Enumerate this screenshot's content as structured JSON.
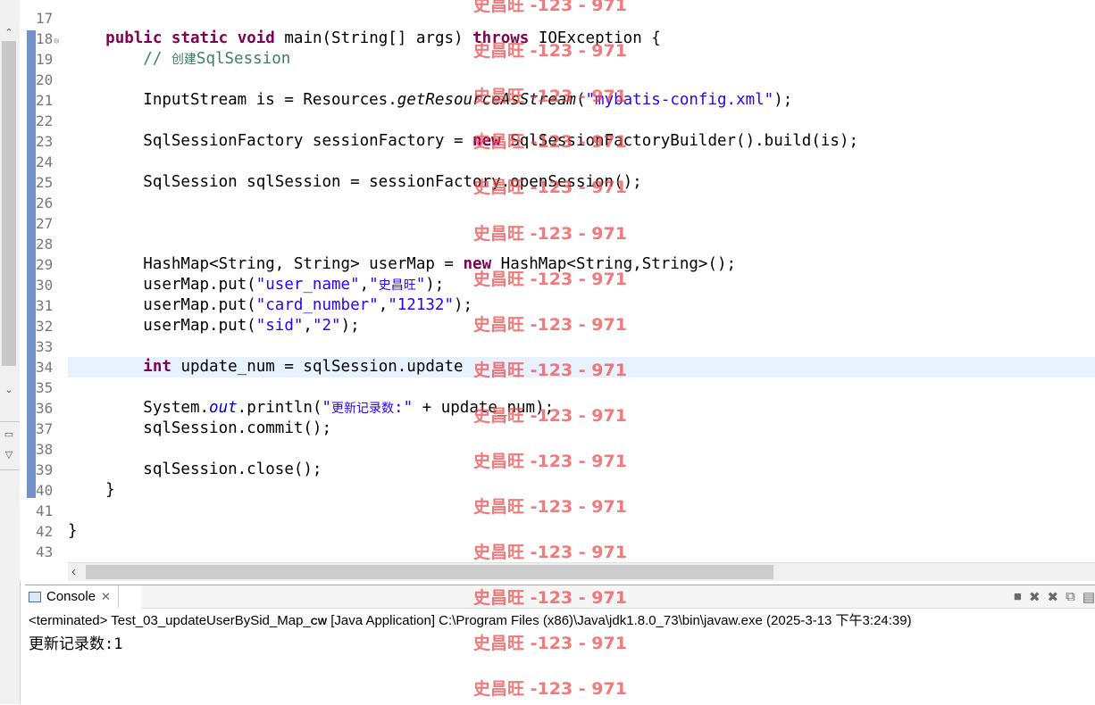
{
  "editor": {
    "lines": [
      {
        "n": "17",
        "tokens": []
      },
      {
        "n": "18",
        "fold": "⊖",
        "tokens": [
          {
            "t": "    "
          },
          {
            "t": "public",
            "c": "kw"
          },
          {
            "t": " "
          },
          {
            "t": "static",
            "c": "kw"
          },
          {
            "t": " "
          },
          {
            "t": "void",
            "c": "kw"
          },
          {
            "t": " main(String[] args) "
          },
          {
            "t": "throws",
            "c": "kw"
          },
          {
            "t": " IOException {"
          }
        ]
      },
      {
        "n": "19",
        "tokens": [
          {
            "t": "        "
          },
          {
            "t": "// ",
            "c": "cm"
          },
          {
            "t": "创建",
            "c": "cm cjk"
          },
          {
            "t": "SqlSession",
            "c": "cm"
          }
        ]
      },
      {
        "n": "20",
        "tokens": []
      },
      {
        "n": "21",
        "tokens": [
          {
            "t": "        InputStream is = Resources."
          },
          {
            "t": "getResourceAsStream",
            "c": "it"
          },
          {
            "t": "("
          },
          {
            "t": "\"mybatis-config.xml\"",
            "c": "str"
          },
          {
            "t": ");"
          }
        ]
      },
      {
        "n": "22",
        "tokens": []
      },
      {
        "n": "23",
        "tokens": [
          {
            "t": "        SqlSessionFactory sessionFactory = "
          },
          {
            "t": "new",
            "c": "kw"
          },
          {
            "t": " SqlSessionFactoryBuilder().build(is);"
          }
        ]
      },
      {
        "n": "24",
        "tokens": []
      },
      {
        "n": "25",
        "tokens": [
          {
            "t": "        SqlSession sqlSession = sessionFactory.openSession();"
          }
        ]
      },
      {
        "n": "26",
        "tokens": []
      },
      {
        "n": "27",
        "tokens": []
      },
      {
        "n": "28",
        "tokens": []
      },
      {
        "n": "29",
        "tokens": [
          {
            "t": "        HashMap<String, String> userMap = "
          },
          {
            "t": "new",
            "c": "kw"
          },
          {
            "t": " HashMap<String,String>();"
          }
        ]
      },
      {
        "n": "30",
        "tokens": [
          {
            "t": "        userMap.put("
          },
          {
            "t": "\"user_name\"",
            "c": "str"
          },
          {
            "t": ","
          },
          {
            "t": "\"",
            "c": "str"
          },
          {
            "t": "史昌旺",
            "c": "str cjk"
          },
          {
            "t": "\"",
            "c": "str"
          },
          {
            "t": ");"
          }
        ]
      },
      {
        "n": "31",
        "tokens": [
          {
            "t": "        userMap.put("
          },
          {
            "t": "\"card_number\"",
            "c": "str"
          },
          {
            "t": ","
          },
          {
            "t": "\"12132\"",
            "c": "str"
          },
          {
            "t": ");"
          }
        ]
      },
      {
        "n": "32",
        "tokens": [
          {
            "t": "        userMap.put("
          },
          {
            "t": "\"sid\"",
            "c": "str"
          },
          {
            "t": ","
          },
          {
            "t": "\"2\"",
            "c": "str"
          },
          {
            "t": ");"
          }
        ]
      },
      {
        "n": "33",
        "tokens": []
      },
      {
        "n": "34",
        "hl": true,
        "tokens": [
          {
            "t": "        "
          },
          {
            "t": "int",
            "c": "kw"
          },
          {
            "t": " update_num = sqlSession.update"
          }
        ]
      },
      {
        "n": "35",
        "tokens": []
      },
      {
        "n": "36",
        "tokens": [
          {
            "t": "        System."
          },
          {
            "t": "out",
            "c": "fld"
          },
          {
            "t": ".println("
          },
          {
            "t": "\"",
            "c": "str"
          },
          {
            "t": "更新记录数",
            "c": "str cjk"
          },
          {
            "t": ":\"",
            "c": "str"
          },
          {
            "t": " + update_num);"
          }
        ]
      },
      {
        "n": "37",
        "tokens": [
          {
            "t": "        sqlSession.commit();"
          }
        ]
      },
      {
        "n": "38",
        "tokens": []
      },
      {
        "n": "39",
        "tokens": [
          {
            "t": "        sqlSession.close();"
          }
        ]
      },
      {
        "n": "40",
        "tokens": [
          {
            "t": "    }"
          }
        ]
      },
      {
        "n": "41",
        "tokens": []
      },
      {
        "n": "42",
        "tokens": [
          {
            "t": "}"
          }
        ]
      },
      {
        "n": "43",
        "tokens": []
      }
    ]
  },
  "console": {
    "tab_label": "Console",
    "tab_close": "✕",
    "status_prefix": "<terminated> Test_03_updateUserBySid_Map_",
    "status_cw": "CW",
    "status_suffix": " [Java Application] C:\\Program Files (x86)\\Java\\jdk1.8.0_73\\bin\\javaw.exe (2025-3-13 下午3:24:39)",
    "output": "更新记录数:1",
    "tools": [
      "■",
      "✖",
      "✖",
      "⧉",
      "▤"
    ]
  },
  "watermark": {
    "text": "史昌旺 -123 - 971"
  },
  "colors": {
    "keyword": "#7f0055",
    "string": "#2a00ff",
    "comment": "#3f7f5f",
    "current_line": "#e8f2fe",
    "watermark": "#ec4646"
  }
}
